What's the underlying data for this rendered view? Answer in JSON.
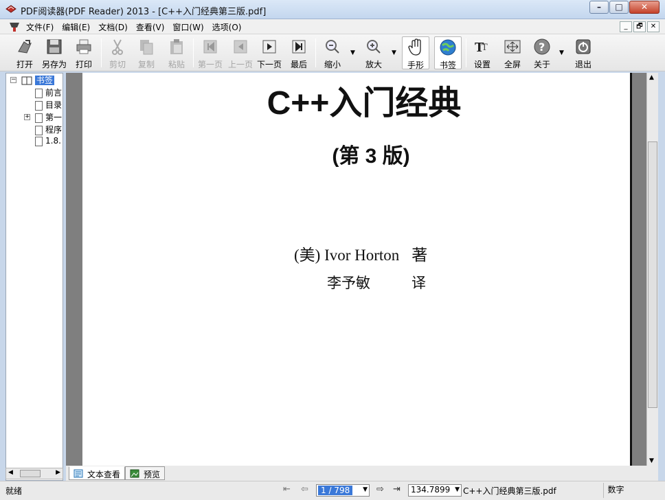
{
  "window": {
    "title": "PDF阅读器(PDF Reader) 2013 - [C++入门经典第三版.pdf]",
    "minimize": "–",
    "maximize": "□",
    "close": "✕"
  },
  "menu": {
    "items": [
      "文件(F)",
      "编辑(E)",
      "文档(D)",
      "查看(V)",
      "窗口(W)",
      "选项(O)"
    ],
    "mdi": [
      "_",
      "🗗",
      "✕"
    ]
  },
  "toolbar": {
    "open": "打开",
    "saveas": "另存为",
    "print": "打印",
    "cut": "剪切",
    "copy": "复制",
    "paste": "粘贴",
    "first": "第一页",
    "prev": "上一页",
    "next": "下一页",
    "last": "最后",
    "zoom_out": "缩小",
    "zoom_in": "放大",
    "hand": "手形",
    "bookmark": "书签",
    "settings": "设置",
    "fullscreen": "全屏",
    "about": "关于",
    "exit": "退出"
  },
  "bookmarks": {
    "root": "书签",
    "items": [
      "前言",
      "目录",
      "第一",
      "程序",
      "1.8."
    ]
  },
  "document": {
    "title": "C++入门经典",
    "edition": "(第 3 版)",
    "author": "(美) Ivor Horton",
    "author_role": "著",
    "translator": "李予敏",
    "translator_role": "译"
  },
  "tabs": {
    "text_view": "文本查看",
    "preview": "预览"
  },
  "status": {
    "text": "就绪",
    "page": "1 / 798",
    "zoom": "134.7899",
    "filename": "C++入门经典第三版.pdf",
    "mode": "数字"
  }
}
